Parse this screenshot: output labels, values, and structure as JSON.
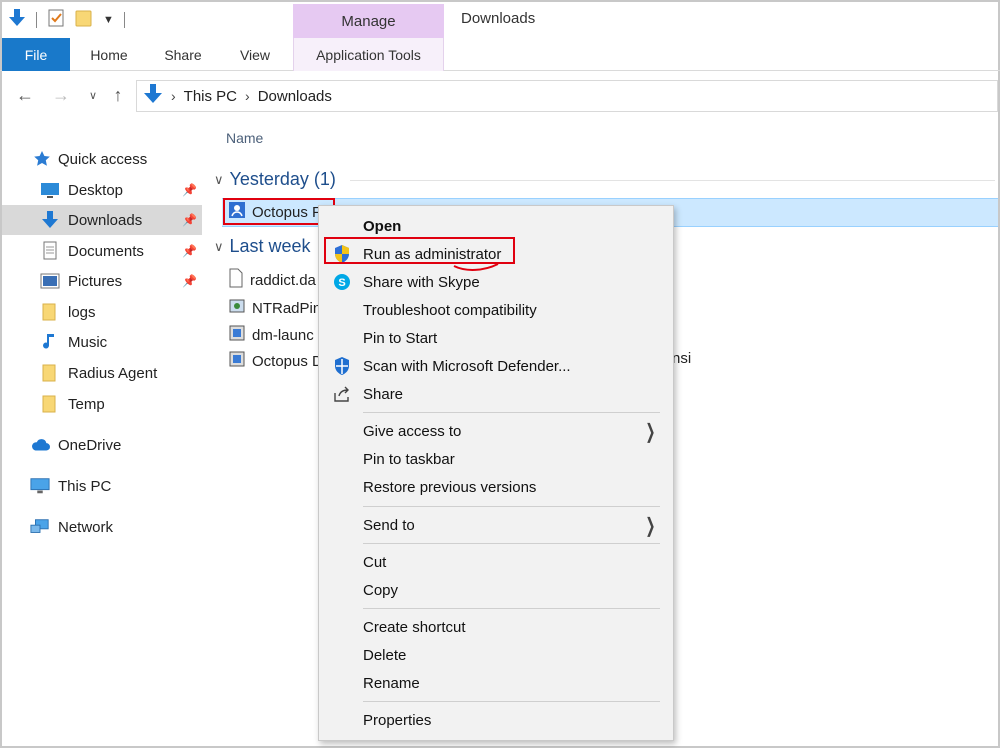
{
  "window": {
    "title": "Downloads"
  },
  "ribbon": {
    "contextual_group": "Manage",
    "tabs": {
      "file": "File",
      "home": "Home",
      "share": "Share",
      "view": "View",
      "app_tools": "Application Tools"
    }
  },
  "address": {
    "crumbs": [
      "This PC",
      "Downloads"
    ]
  },
  "navpane": {
    "items": [
      {
        "label": "Quick access",
        "icon": "star-icon"
      },
      {
        "label": "Desktop",
        "icon": "desktop-icon",
        "pinned": true
      },
      {
        "label": "Downloads",
        "icon": "download-icon",
        "pinned": true,
        "selected": true
      },
      {
        "label": "Documents",
        "icon": "document-icon",
        "pinned": true
      },
      {
        "label": "Pictures",
        "icon": "pictures-icon",
        "pinned": true
      },
      {
        "label": "logs",
        "icon": "folder-icon"
      },
      {
        "label": "Music",
        "icon": "music-icon"
      },
      {
        "label": "Radius Agent",
        "icon": "folder-icon"
      },
      {
        "label": "Temp",
        "icon": "folder-icon"
      },
      {
        "label": "OneDrive",
        "icon": "cloud-icon"
      },
      {
        "label": "This PC",
        "icon": "computer-icon"
      },
      {
        "label": "Network",
        "icon": "network-icon"
      }
    ]
  },
  "filelist": {
    "column_name": "Name",
    "groups": [
      {
        "label": "Yesterday (1)"
      },
      {
        "label": "Last week"
      }
    ],
    "files": [
      {
        "name": "Octopus F",
        "icon": "installer-icon"
      },
      {
        "name": "raddict.da",
        "icon": "file-icon"
      },
      {
        "name": "NTRadPin",
        "icon": "app-icon"
      },
      {
        "name": "dm-launc",
        "icon": "setup-icon"
      },
      {
        "name": "Octopus D",
        "icon": "setup-icon"
      }
    ],
    "trailing_text": "nsi"
  },
  "context_menu": {
    "items": [
      {
        "label": "Open",
        "bold": true
      },
      {
        "label": "Run as administrator",
        "icon": "shield-icon",
        "highlighted": true
      },
      {
        "label": "Share with Skype",
        "icon": "skype-icon"
      },
      {
        "label": "Troubleshoot compatibility"
      },
      {
        "label": "Pin to Start"
      },
      {
        "label": "Scan with Microsoft Defender...",
        "icon": "defender-icon"
      },
      {
        "label": "Share",
        "icon": "share-icon"
      },
      {
        "label": "Give access to",
        "submenu": true
      },
      {
        "label": "Pin to taskbar"
      },
      {
        "label": "Restore previous versions"
      },
      {
        "label": "Send to",
        "submenu": true
      },
      {
        "label": "Cut"
      },
      {
        "label": "Copy"
      },
      {
        "label": "Create shortcut"
      },
      {
        "label": "Delete"
      },
      {
        "label": "Rename"
      },
      {
        "label": "Properties"
      }
    ]
  },
  "colors": {
    "file_tab": "#1979ca",
    "manage_tab": "#e6c9f2",
    "highlight_box": "#e0000f",
    "selection": "#cce8ff",
    "group_header": "#1e4e8c"
  }
}
